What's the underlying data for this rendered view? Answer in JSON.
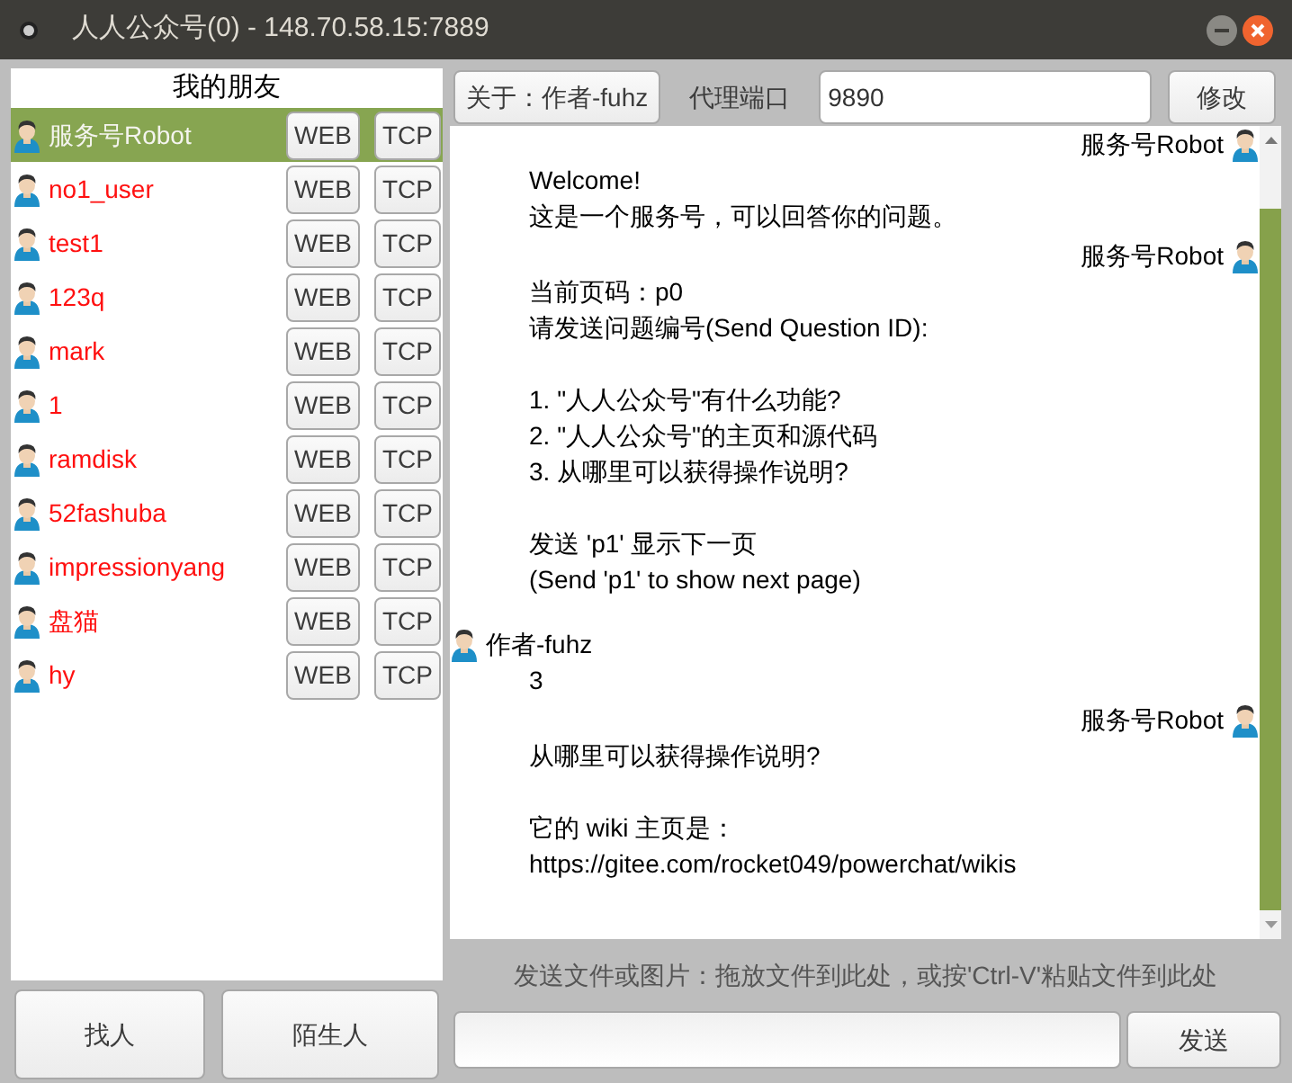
{
  "window": {
    "title": "人人公众号(0) - 148.70.58.15:7889"
  },
  "friends": {
    "title": "我的朋友",
    "items": [
      {
        "name": "服务号Robot",
        "selected": true,
        "web": "WEB",
        "tcp": "TCP"
      },
      {
        "name": "no1_user",
        "selected": false,
        "web": "WEB",
        "tcp": "TCP"
      },
      {
        "name": "test1",
        "selected": false,
        "web": "WEB",
        "tcp": "TCP"
      },
      {
        "name": "123q",
        "selected": false,
        "web": "WEB",
        "tcp": "TCP"
      },
      {
        "name": "mark",
        "selected": false,
        "web": "WEB",
        "tcp": "TCP"
      },
      {
        "name": "1",
        "selected": false,
        "web": "WEB",
        "tcp": "TCP"
      },
      {
        "name": "ramdisk",
        "selected": false,
        "web": "WEB",
        "tcp": "TCP"
      },
      {
        "name": "52fashuba",
        "selected": false,
        "web": "WEB",
        "tcp": "TCP"
      },
      {
        "name": "impressionyang",
        "selected": false,
        "web": "WEB",
        "tcp": "TCP"
      },
      {
        "name": "盘猫",
        "selected": false,
        "web": "WEB",
        "tcp": "TCP"
      },
      {
        "name": "hy",
        "selected": false,
        "web": "WEB",
        "tcp": "TCP"
      }
    ],
    "buttons": [
      "找人",
      "陌生人"
    ]
  },
  "toolbar": {
    "about": "关于：作者-fuhz",
    "proxy_label": "代理端口",
    "proxy_value": "9890",
    "modify": "修改"
  },
  "messages": [
    {
      "sender": "服务号Robot",
      "from_self": false,
      "paragraphs": [
        [
          "Welcome!",
          "这是一个服务号，可以回答你的问题。"
        ]
      ]
    },
    {
      "sender": "服务号Robot",
      "from_self": false,
      "paragraphs": [
        [
          "当前页码：p0",
          "请发送问题编号(Send Question ID):"
        ],
        [
          "1. \"人人公众号\"有什么功能?",
          "2. \"人人公众号\"的主页和源代码",
          "3. 从哪里可以获得操作说明?"
        ],
        [
          "发送 'p1' 显示下一页",
          "(Send 'p1' to show next page)"
        ]
      ]
    },
    {
      "sender": "作者-fuhz",
      "from_self": true,
      "paragraphs": [
        [
          "3"
        ]
      ]
    },
    {
      "sender": "服务号Robot",
      "from_self": false,
      "paragraphs": [
        [
          "从哪里可以获得操作说明?"
        ],
        [
          "它的 wiki 主页是：",
          "https://gitee.com/rocket049/powerchat/wikis"
        ]
      ]
    }
  ],
  "hint": "发送文件或图片：拖放文件到此处，或按'Ctrl-V'粘贴文件到此处",
  "send": "发送"
}
